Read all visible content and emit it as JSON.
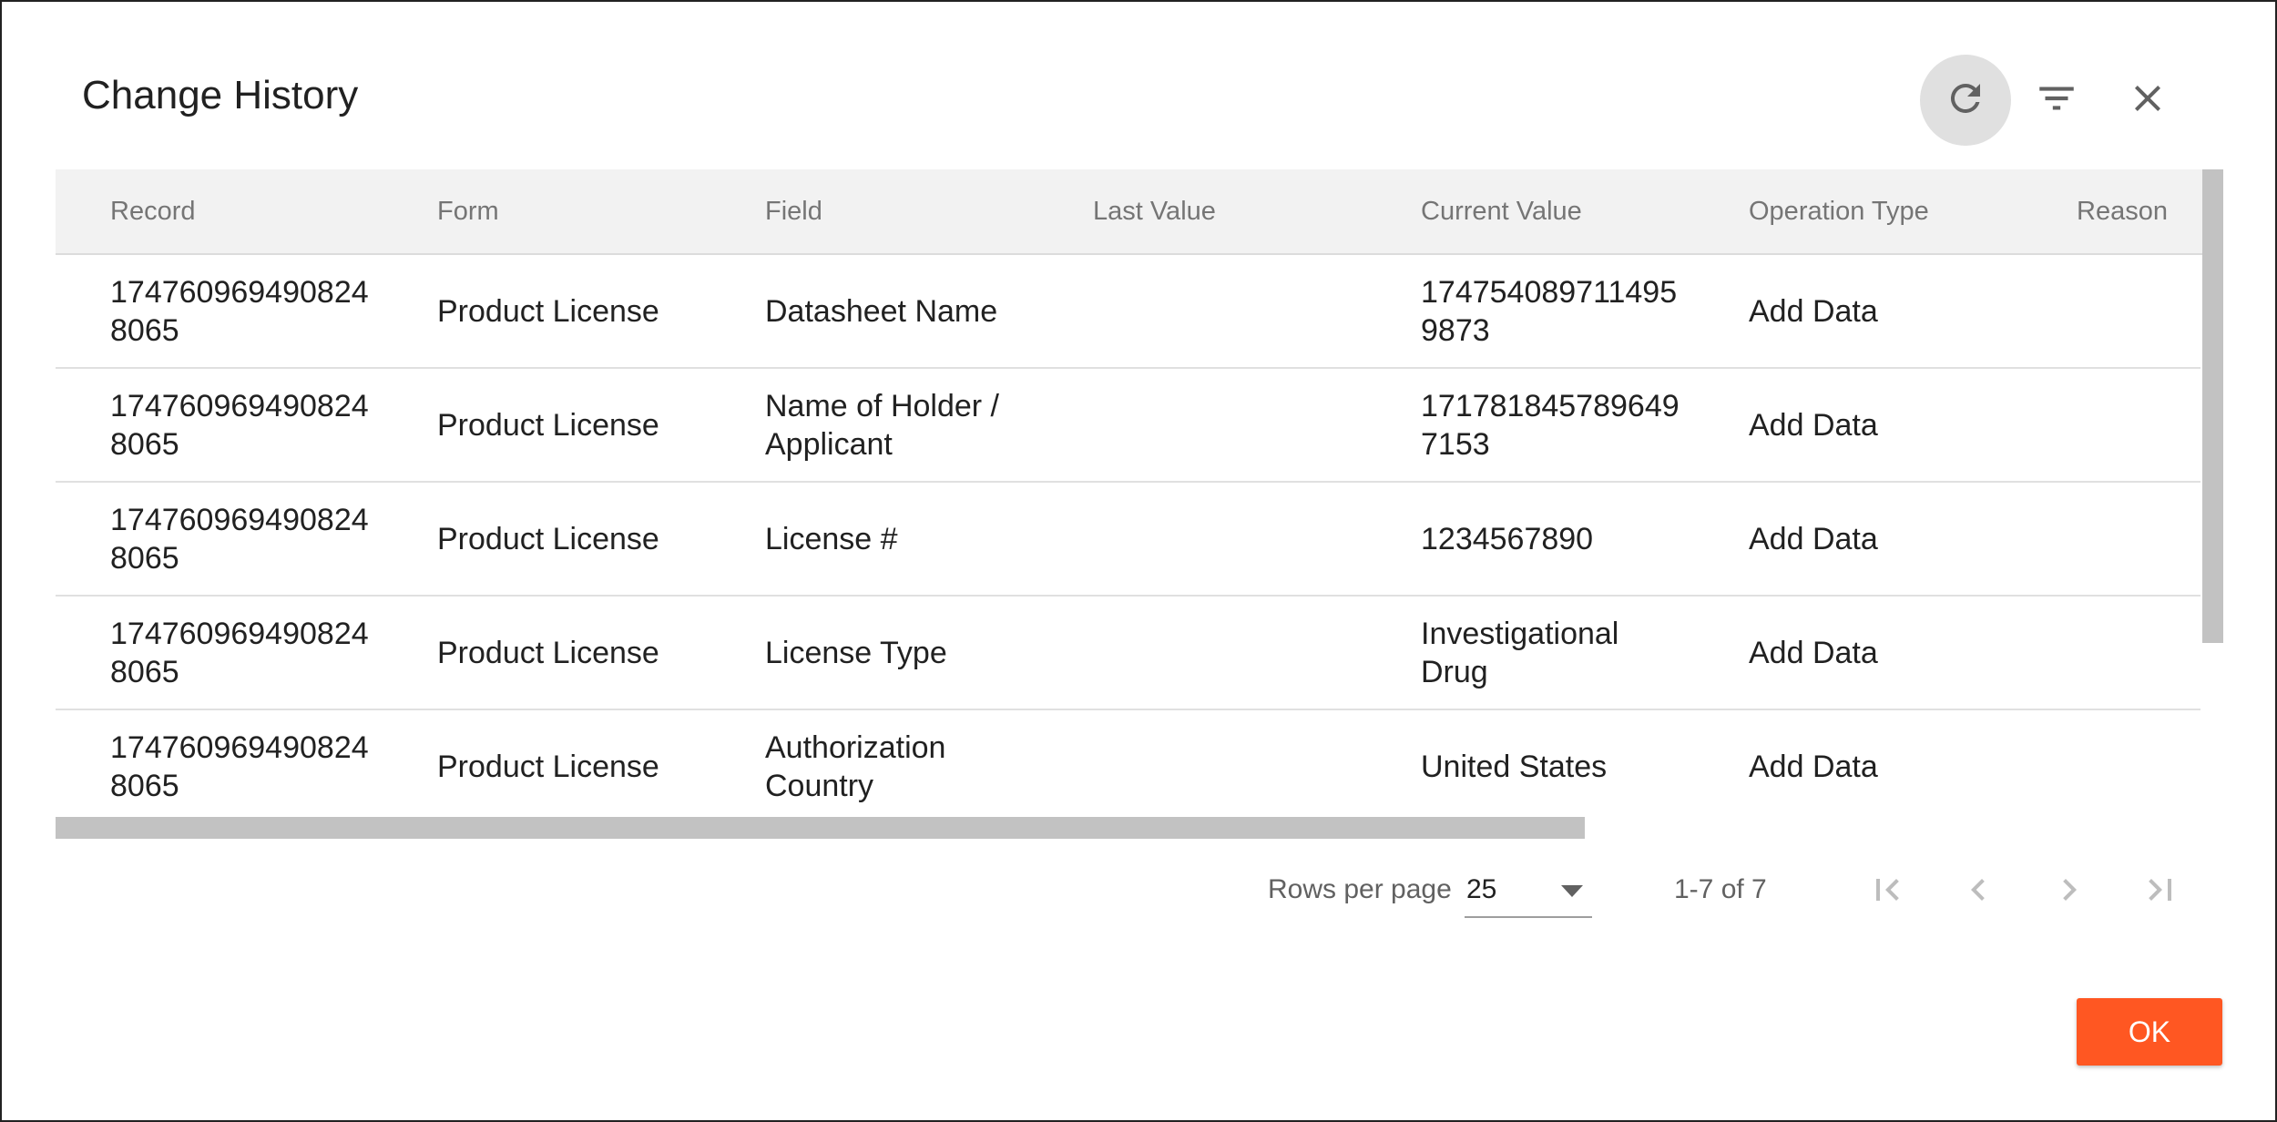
{
  "dialog": {
    "title": "Change History"
  },
  "toolbar": {
    "refresh_icon": "refresh-icon",
    "filter_icon": "filter-icon",
    "close_icon": "close-icon"
  },
  "table": {
    "columns": [
      "Record",
      "Form",
      "Field",
      "Last Value",
      "Current Value",
      "Operation Type",
      "Reason"
    ],
    "rows": [
      {
        "record": "1747609694908248065",
        "form": "Product License",
        "field": "Datasheet Name",
        "last_value": "",
        "current_value": "1747540897114959873",
        "operation_type": "Add Data",
        "reason": ""
      },
      {
        "record": "1747609694908248065",
        "form": "Product License",
        "field": "Name of Holder / Applicant",
        "last_value": "",
        "current_value": "1717818457896497153",
        "operation_type": "Add Data",
        "reason": ""
      },
      {
        "record": "1747609694908248065",
        "form": "Product License",
        "field": "License #",
        "last_value": "",
        "current_value": "1234567890",
        "operation_type": "Add Data",
        "reason": ""
      },
      {
        "record": "1747609694908248065",
        "form": "Product License",
        "field": "License Type",
        "last_value": "",
        "current_value": "Investigational Drug",
        "operation_type": "Add Data",
        "reason": ""
      },
      {
        "record": "1747609694908248065",
        "form": "Product License",
        "field": "Authorization Country",
        "last_value": "",
        "current_value": "United States",
        "operation_type": "Add Data",
        "reason": ""
      }
    ]
  },
  "pagination": {
    "rows_per_page_label": "Rows per page",
    "rows_per_page_value": "25",
    "range_text": "1-7 of 7"
  },
  "footer": {
    "ok_label": "OK"
  },
  "colors": {
    "accent": "#ff5722",
    "header_bg": "#f2f2f2",
    "scrollbar": "#c2c2c2"
  }
}
